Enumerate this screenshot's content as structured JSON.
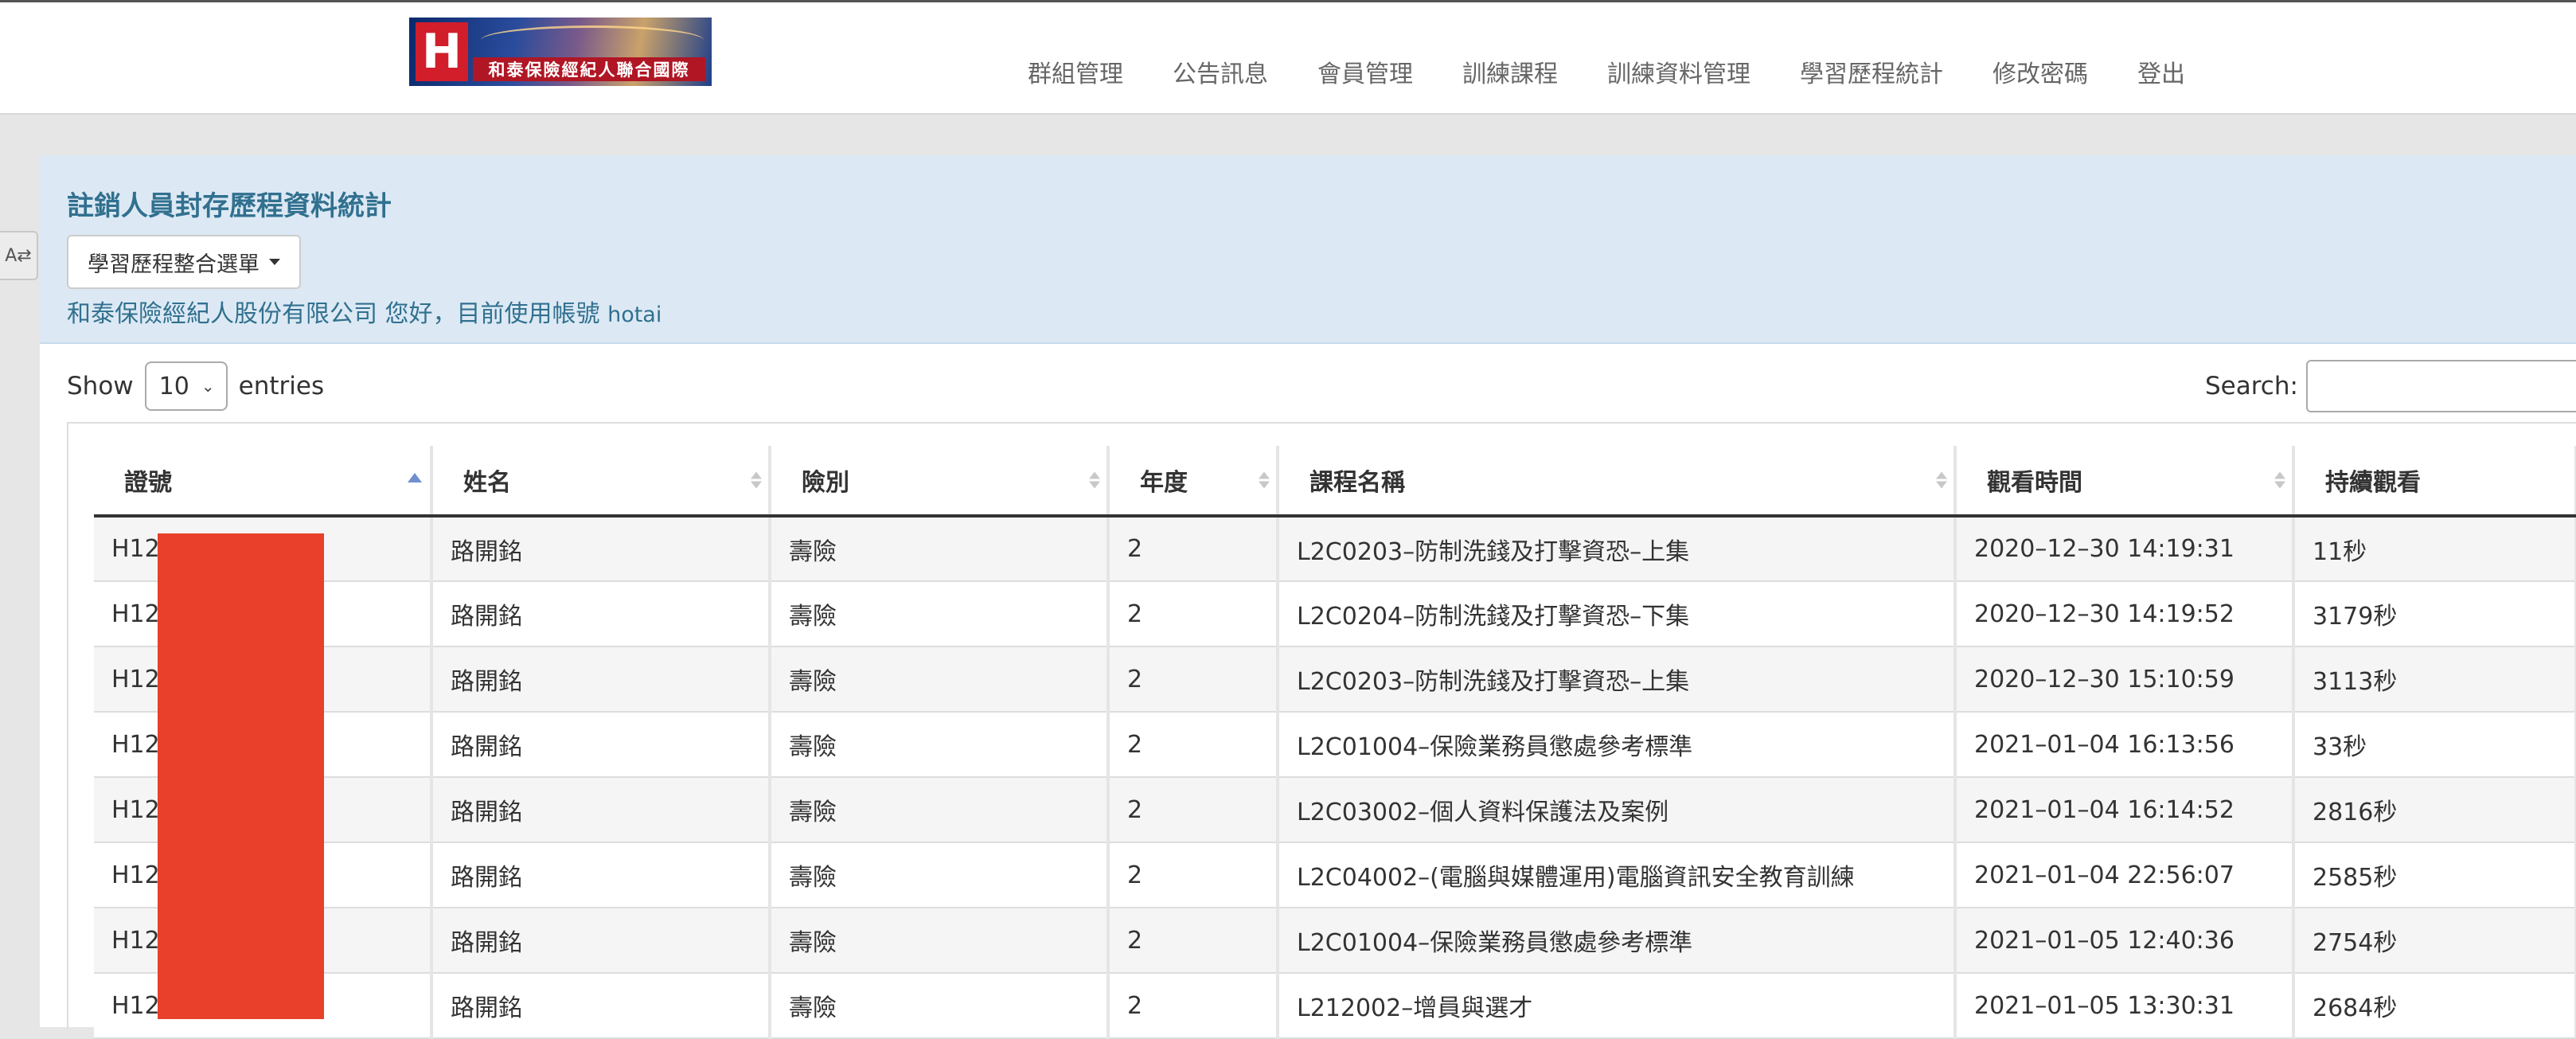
{
  "logo": {
    "letter": "H",
    "text": "和泰保險經紀人聯合國際"
  },
  "nav": {
    "items": [
      "群組管理",
      "公告訊息",
      "會員管理",
      "訓練課程",
      "訓練資料管理",
      "學習歷程統計",
      "修改密碼",
      "登出"
    ]
  },
  "side_tab": {
    "label": "A⇄"
  },
  "header": {
    "title": "註銷人員封存歷程資料統計",
    "menu_button": "學習歷程整合選單",
    "welcome": "和泰保險經紀人股份有限公司 您好，目前使用帳號",
    "account": "hotai"
  },
  "table_controls": {
    "show_label": "Show",
    "entries_value": "10",
    "entries_label": "entries",
    "search_label": "Search:",
    "search_value": ""
  },
  "table": {
    "columns": [
      "證號",
      "姓名",
      "險別",
      "年度",
      "課程名稱",
      "觀看時間",
      "持續觀看"
    ],
    "sorted_column": "證號",
    "sort_direction": "asc",
    "rows": [
      [
        "H12",
        "路開銘",
        "壽險",
        "2",
        "L2C0203–防制洗錢及打擊資恐–上集",
        "2020–12–30 14:19:31",
        "11秒"
      ],
      [
        "H12",
        "路開銘",
        "壽險",
        "2",
        "L2C0204–防制洗錢及打擊資恐–下集",
        "2020–12–30 14:19:52",
        "3179秒"
      ],
      [
        "H12",
        "路開銘",
        "壽險",
        "2",
        "L2C0203–防制洗錢及打擊資恐–上集",
        "2020–12–30 15:10:59",
        "3113秒"
      ],
      [
        "H12",
        "路開銘",
        "壽險",
        "2",
        "L2C01004–保險業務員懲處參考標準",
        "2021–01–04 16:13:56",
        "33秒"
      ],
      [
        "H12",
        "路開銘",
        "壽險",
        "2",
        "L2C03002–個人資料保護法及案例",
        "2021–01–04 16:14:52",
        "2816秒"
      ],
      [
        "H12",
        "路開銘",
        "壽險",
        "2",
        "L2C04002–(電腦與媒體運用)電腦資訊安全教育訓練",
        "2021–01–04 22:56:07",
        "2585秒"
      ],
      [
        "H12",
        "路開銘",
        "壽險",
        "2",
        "L2C01004–保險業務員懲處參考標準",
        "2021–01–05 12:40:36",
        "2754秒"
      ],
      [
        "H12",
        "路開銘",
        "壽險",
        "2",
        "L212002–增員與選才",
        "2021–01–05 13:30:31",
        "2684秒"
      ]
    ]
  },
  "colors": {
    "header_bg": "#dce9f4",
    "title_color": "#31708f",
    "redaction": "#e8402a"
  }
}
